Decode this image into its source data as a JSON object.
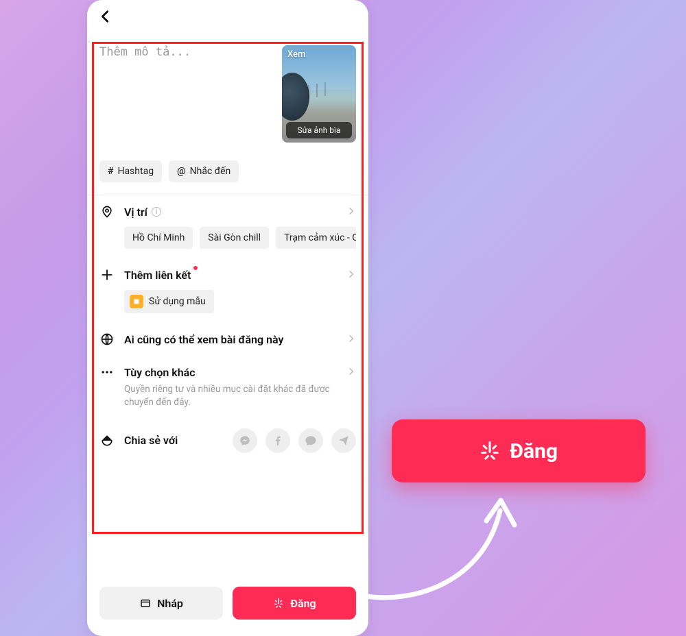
{
  "header": {},
  "description": {
    "placeholder": "Thêm mô tả...",
    "value": ""
  },
  "thumbnail": {
    "top_label": "Xem",
    "bottom_label": "Sửa ảnh bìa"
  },
  "pills": {
    "hashtag": "Hashtag",
    "mention": "Nhắc đến"
  },
  "location": {
    "title": "Vị trí",
    "suggestions": [
      "Hồ Chí Minh",
      "Sài Gòn chill",
      "Trạm cảm xúc - Cafe ru"
    ]
  },
  "link": {
    "title": "Thêm liên kết",
    "template_label": "Sử dụng mẫu"
  },
  "privacy": {
    "title": "Ai cũng có thể xem bài đăng này"
  },
  "more": {
    "title": "Tùy chọn khác",
    "subtitle": "Quyền riêng tư và nhiều mục cài đặt khác đã được chuyển đến đây."
  },
  "share": {
    "title": "Chia sẻ với"
  },
  "buttons": {
    "draft": "Nháp",
    "post": "Đăng"
  },
  "callout": {
    "label": "Đăng"
  }
}
